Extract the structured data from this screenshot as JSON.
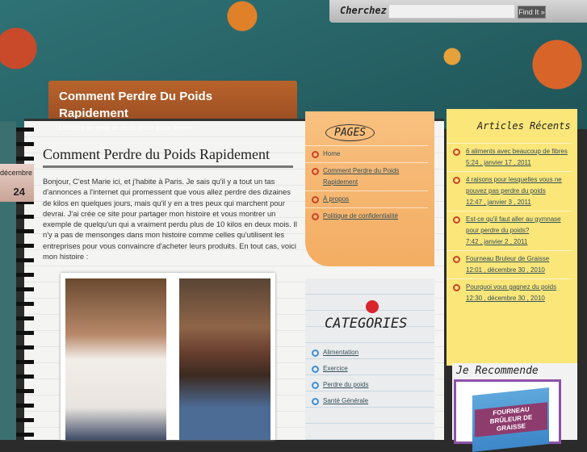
{
  "search": {
    "label": "Cherchez",
    "placeholder": "",
    "button": "Find It »"
  },
  "site": {
    "title": "Comment Perdre Du Poids Rapidement",
    "tagline": "L'histoire de perte de poids d'une jeune femme"
  },
  "date": {
    "month": "décembre",
    "day": "24"
  },
  "post": {
    "title": "Comment Perdre du Poids Rapidement",
    "body": "Bonjour, C'est Marie ici, et j'habite à Paris. Je sais qu'il y a tout un tas d'annonces a l'internet qui promessent que vous allez perdre des dizaines de kilos en quelques jours, mais qu'il y en a tres peux qui marchent pour devrai. J'ai crée ce site pour partager mon histoire et vous montrer un exemple de quelqu'un qui a vraiment perdu plus de 10 kilos en deux mois. Il n'y a pas de mensonges dans mon histoire comme celles qu'utilisent les entreprises pour vous convaincre d'acheter leurs produits. En tout cas, voici mon histoire :"
  },
  "pages": {
    "title": "PAGES",
    "items": [
      "Home",
      "Comment Perdre du Poids Rapidement",
      "À propos",
      "Politique de confidentialité"
    ]
  },
  "categories": {
    "title": "CATEGORIES",
    "items": [
      "Alimentation",
      "Exercice",
      "Perdre du poids",
      "Santé Générale"
    ]
  },
  "recent": {
    "title": "Articles Récents",
    "items": [
      {
        "title": "6 aliments avec beaucoup de fibres",
        "date": "5:24 , janvier 17 , 2011"
      },
      {
        "title": "4 raisons pour lesquelles vous ne pouvez pas perdre du poids",
        "date": "12:47 , janvier 3 , 2011"
      },
      {
        "title": "Est-ce qu'il faut aller au gymnase pour perdre du poids?",
        "date": "7:42 , janvier 2 , 2011"
      },
      {
        "title": "Fourneau Bruleur de Graisse",
        "date": "12:01 , décembre 30 , 2010"
      },
      {
        "title": "Pourquoi vous gagnez du poids",
        "date": "12:30 , décembre 30 , 2010"
      }
    ]
  },
  "recommend": {
    "title": "Je Recommende",
    "book": "FOURNEAU BRÛLEUR DE GRAISSE"
  }
}
